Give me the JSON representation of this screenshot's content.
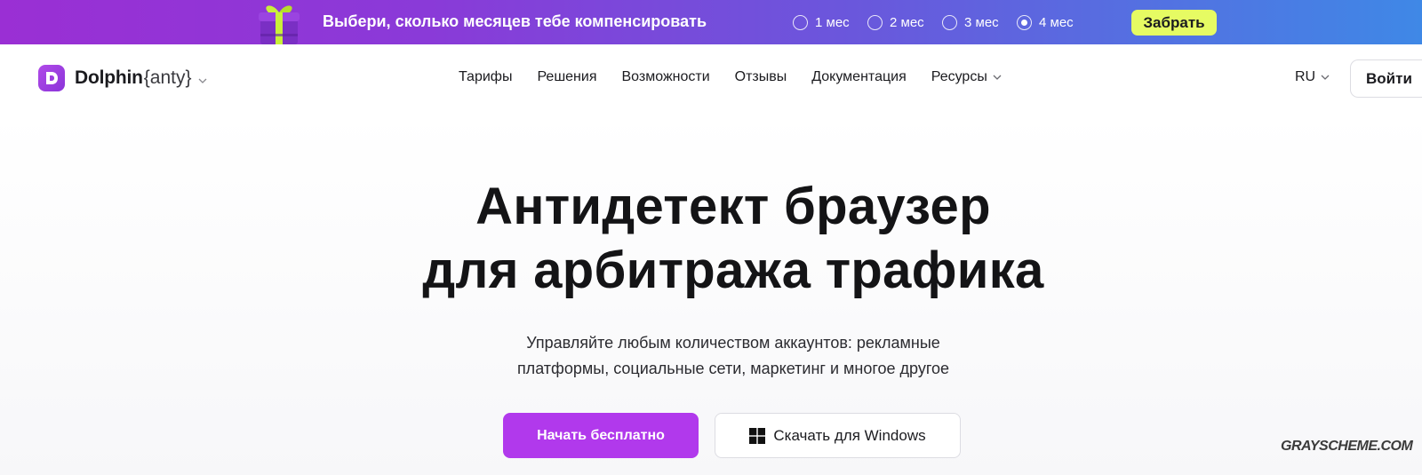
{
  "promo": {
    "text": "Выбери, сколько месяцев тебе компенсировать",
    "options": [
      {
        "label": "1 мес",
        "selected": false
      },
      {
        "label": "2 мес",
        "selected": false
      },
      {
        "label": "3 мес",
        "selected": false
      },
      {
        "label": "4 мес",
        "selected": true
      }
    ],
    "claim_label": "Забрать",
    "gradient": [
      "#9a2fd4",
      "#3f88e6"
    ],
    "claim_color": "#e6fb63"
  },
  "nav": {
    "logo_letter": "D",
    "logo_name": "Dolphin",
    "logo_suffix": "{anty}",
    "items": [
      "Тарифы",
      "Решения",
      "Возможности",
      "Отзывы",
      "Документация",
      "Ресурсы"
    ],
    "lang": "RU",
    "login_label": "Войти"
  },
  "hero": {
    "title_line1": "Антидетект браузер",
    "title_line2": "для арбитража трафика",
    "subtitle_line1": "Управляйте любым количеством аккаунтов: рекламные",
    "subtitle_line2": "платформы, социальные сети, маркетинг и многое другое",
    "primary_cta": "Начать бесплатно",
    "secondary_cta": "Скачать для Windows",
    "accent": "#b139ec"
  },
  "watermark": "GRAYSCHEME.COM"
}
